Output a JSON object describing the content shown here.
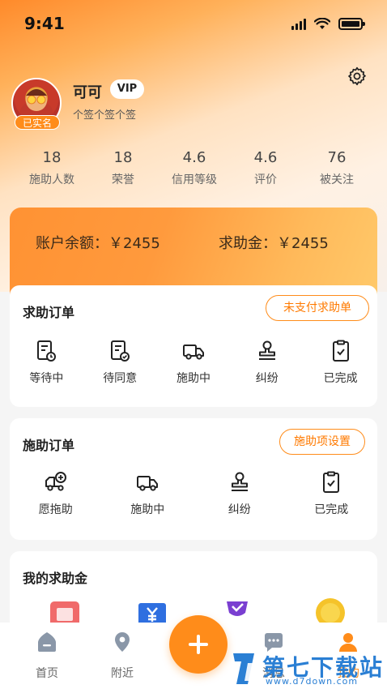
{
  "status_bar": {
    "time": "9:41"
  },
  "profile": {
    "name": "可可",
    "vip_label": "VIP",
    "verified_badge": "已实名",
    "signature": "个签个签个签"
  },
  "stats": [
    {
      "value": "18",
      "label": "施助人数"
    },
    {
      "value": "18",
      "label": "荣誉"
    },
    {
      "value": "4.6",
      "label": "信用等级"
    },
    {
      "value": "4.6",
      "label": "评价"
    },
    {
      "value": "76",
      "label": "被关注"
    }
  ],
  "balance": {
    "account_text": "账户余额：￥2455",
    "help_fund_text": "求助金：￥2455"
  },
  "help_orders": {
    "title": "求助订单",
    "action": "未支付求助单",
    "items": [
      "等待中",
      "待同意",
      "施助中",
      "纠纷",
      "已完成"
    ]
  },
  "assist_orders": {
    "title": "施助订单",
    "action": "施助项设置",
    "items": [
      "愿拖助",
      "施助中",
      "纠纷",
      "已完成"
    ]
  },
  "my_fund": {
    "title": "我的求助金"
  },
  "bottom_nav": {
    "items": [
      "首页",
      "附近",
      "消息",
      "我的"
    ]
  },
  "watermark": {
    "main": "第七下载站",
    "sub": "www.d7down.com"
  },
  "colors": {
    "accent": "#ff8c1a",
    "card_bg": "#ffffff",
    "page_bg": "#f5f5f5"
  }
}
